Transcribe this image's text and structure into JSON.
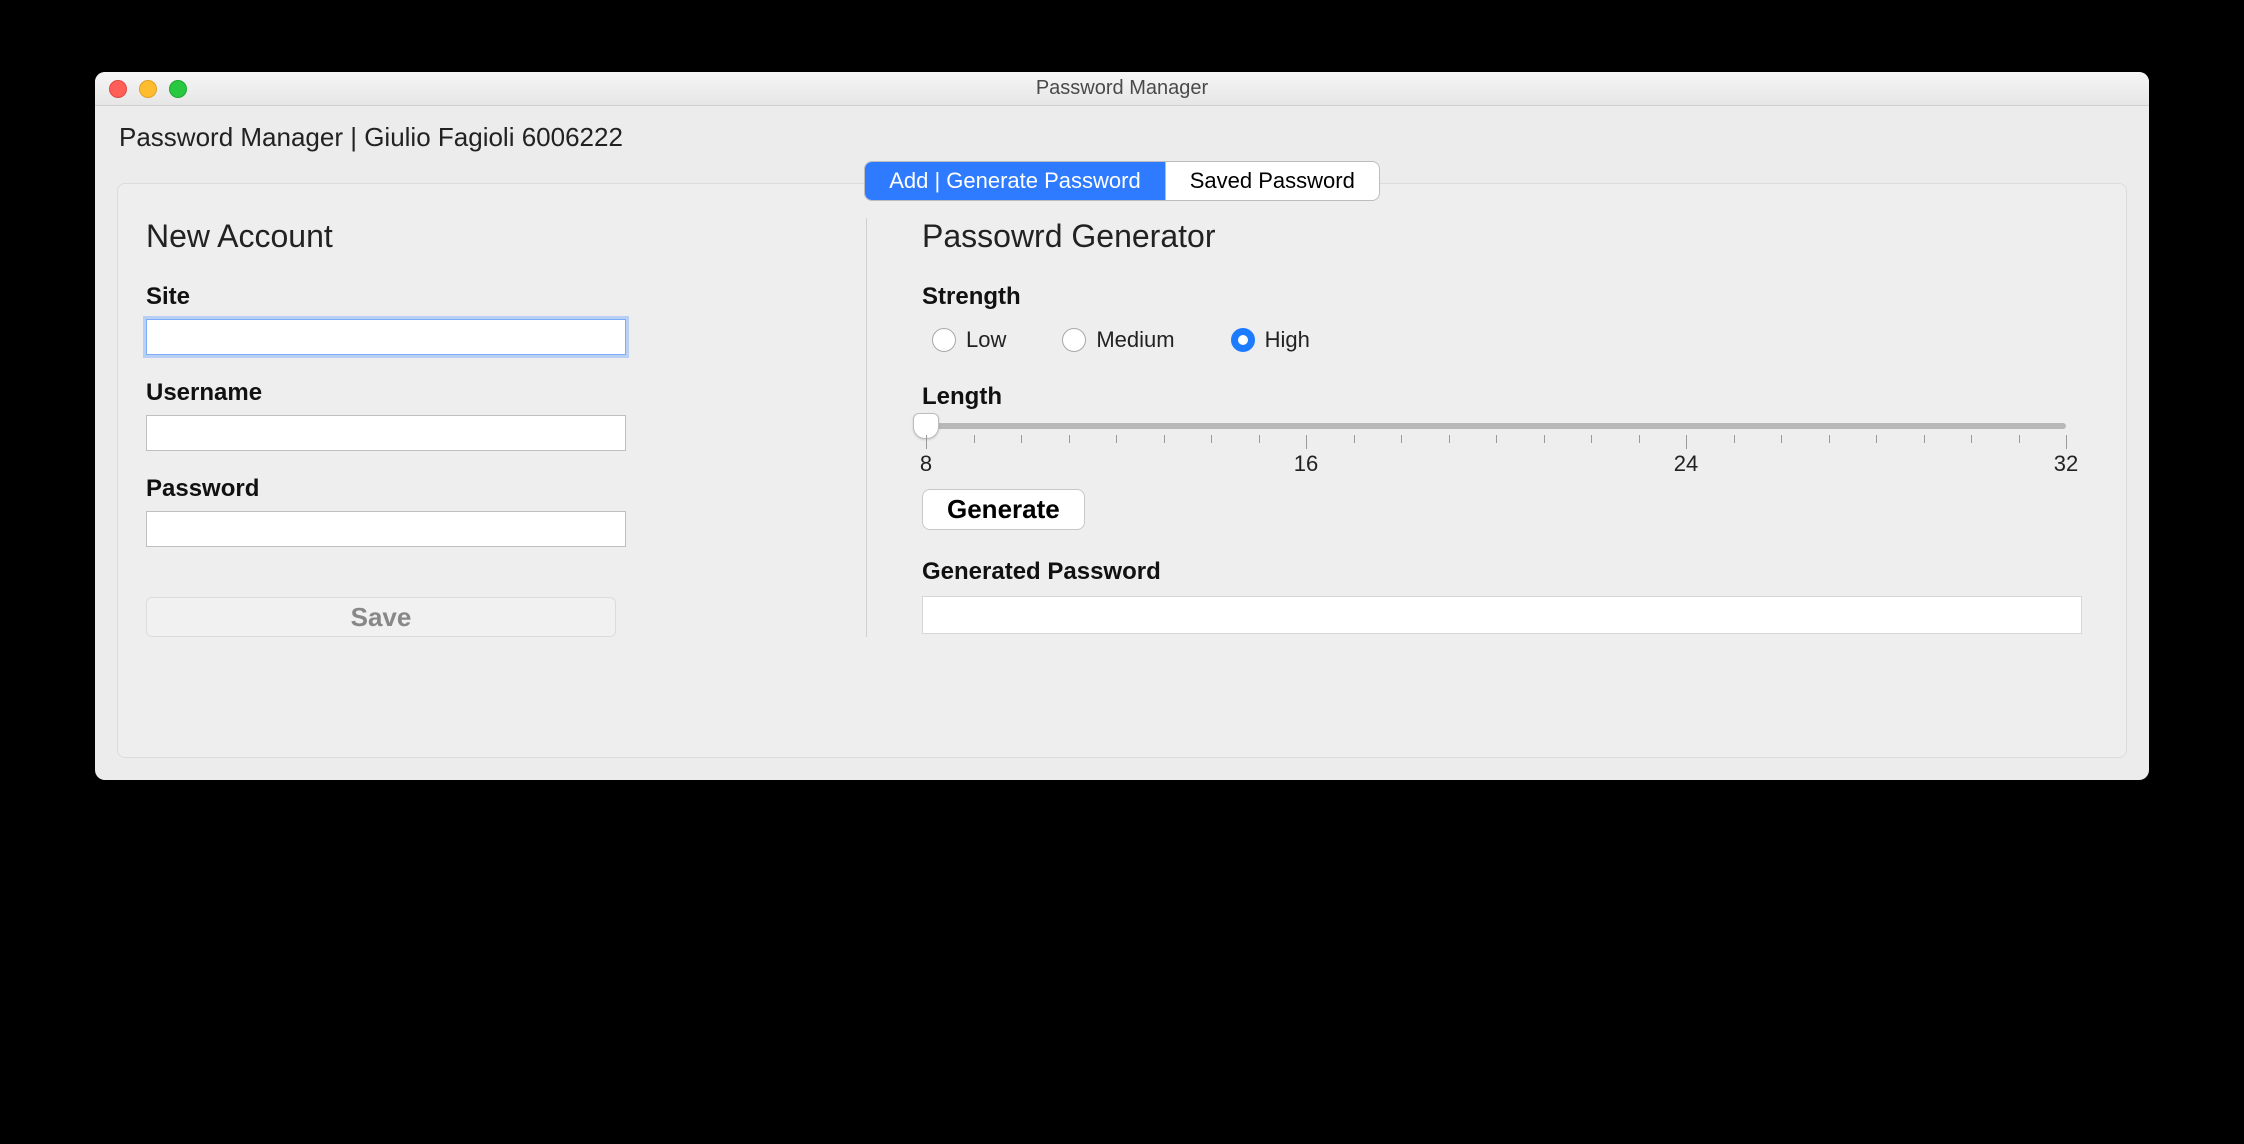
{
  "window": {
    "title": "Password Manager",
    "subtitle": "Password Manager | Giulio Fagioli 6006222"
  },
  "tabs": {
    "add_generate": "Add | Generate Password",
    "saved": "Saved Password",
    "active": "add_generate"
  },
  "left": {
    "heading": "New Account",
    "site_label": "Site",
    "site_value": "",
    "username_label": "Username",
    "username_value": "",
    "password_label": "Password",
    "password_value": "",
    "save_label": "Save"
  },
  "right": {
    "heading": "Passowrd Generator",
    "strength_label": "Strength",
    "strength_options": {
      "low": "Low",
      "medium": "Medium",
      "high": "High"
    },
    "strength_selected": "high",
    "length_label": "Length",
    "length_min": 8,
    "length_max": 32,
    "length_value": 8,
    "length_ticks_major": [
      8,
      16,
      24,
      32
    ],
    "generate_label": "Generate",
    "generated_label": "Generated Password",
    "generated_value": ""
  }
}
